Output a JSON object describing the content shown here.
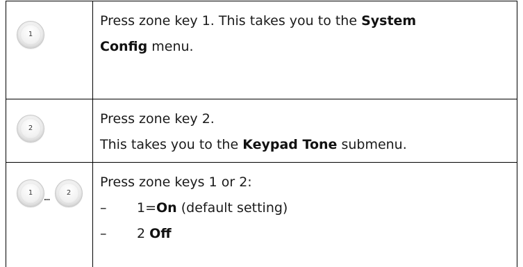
{
  "steps": [
    {
      "keys": [
        "1"
      ],
      "lines": [
        {
          "pre": "Press zone key 1. This takes you to the ",
          "bold": "System",
          "post": ""
        },
        {
          "pre": "",
          "bold": "Config",
          "post": " menu."
        }
      ]
    },
    {
      "keys": [
        "2"
      ],
      "lines": [
        {
          "pre": "Press zone key 2.",
          "bold": "",
          "post": ""
        },
        {
          "pre": "This takes you to the ",
          "bold": "Keypad Tone",
          "post": " submenu."
        }
      ]
    },
    {
      "keys": [
        "1",
        "2"
      ],
      "separator": "...",
      "intro": "Press zone keys 1 or 2:",
      "bullets": [
        {
          "dash": "–",
          "pre": "1=",
          "bold": "On",
          "post": " (default setting)"
        },
        {
          "dash": "–",
          "pre": "2 ",
          "bold": "Off",
          "post": ""
        }
      ]
    }
  ]
}
